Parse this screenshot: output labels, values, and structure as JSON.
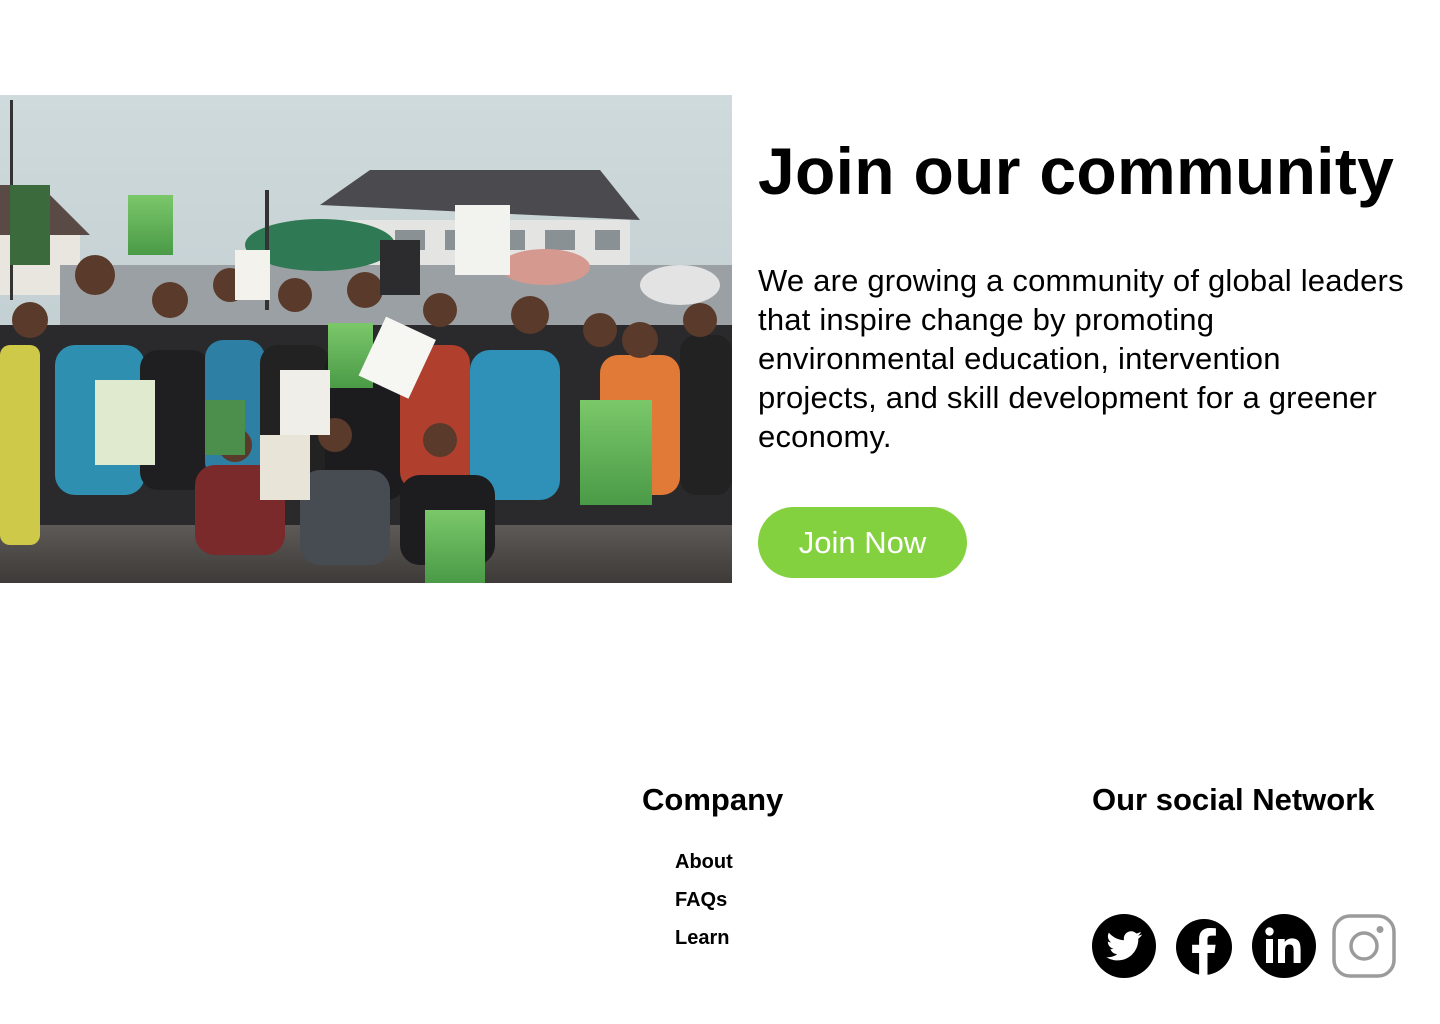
{
  "hero": {
    "title": "Join our community",
    "body": "We are growing a community of global leaders that inspire change by promoting environmental education, intervention projects, and skill development for a greener economy.",
    "button_label": "Join Now",
    "photo_alt": "Group of volunteers holding signs at a community clean-up",
    "accent_color": "#84d13f"
  },
  "footer": {
    "company_heading": "Company",
    "company_links": [
      {
        "label": "About"
      },
      {
        "label": "FAQs"
      },
      {
        "label": "Learn"
      }
    ],
    "social_heading": "Our social Network",
    "social_icons": [
      {
        "name": "twitter-icon"
      },
      {
        "name": "facebook-icon"
      },
      {
        "name": "linkedin-icon"
      },
      {
        "name": "instagram-icon"
      }
    ]
  }
}
